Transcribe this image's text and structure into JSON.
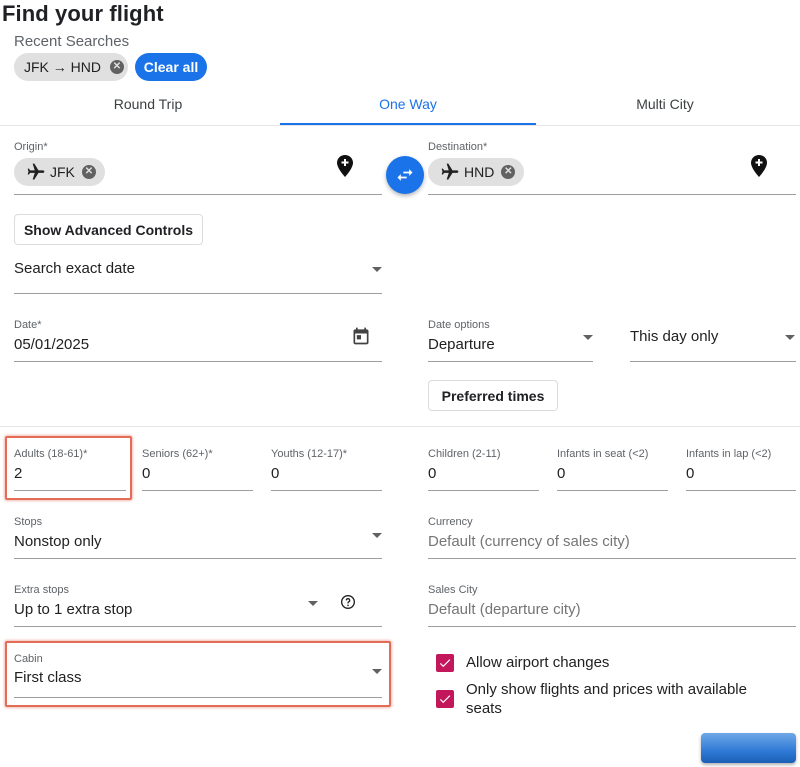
{
  "header": {
    "title": "Find your flight"
  },
  "recent": {
    "label": "Recent Searches",
    "chip": "JFK → HND",
    "clear_all": "Clear all"
  },
  "tabs": [
    {
      "label": "Round Trip",
      "active": false
    },
    {
      "label": "One Way",
      "active": true
    },
    {
      "label": "Multi City",
      "active": false
    }
  ],
  "origin": {
    "label": "Origin*",
    "chip": "JFK"
  },
  "destination": {
    "label": "Destination*",
    "chip": "HND"
  },
  "advanced": {
    "label": "Show Advanced Controls"
  },
  "search_mode": {
    "value": "Search exact date"
  },
  "date": {
    "label": "Date*",
    "value": "05/01/2025"
  },
  "date_options": {
    "label": "Date options",
    "value": "Departure"
  },
  "day_scope": {
    "value": "This day only"
  },
  "preferred_times": {
    "label": "Preferred times"
  },
  "passengers": {
    "adults": {
      "label": "Adults (18-61)*",
      "value": "2"
    },
    "seniors": {
      "label": "Seniors (62+)*",
      "value": "0"
    },
    "youths": {
      "label": "Youths (12-17)*",
      "value": "0"
    },
    "children": {
      "label": "Children (2-11)",
      "value": "0"
    },
    "infants_seat": {
      "label": "Infants in seat (<2)",
      "value": "0"
    },
    "infants_lap": {
      "label": "Infants in lap (<2)",
      "value": "0"
    }
  },
  "stops": {
    "label": "Stops",
    "value": "Nonstop only"
  },
  "currency": {
    "label": "Currency",
    "placeholder": "Default (currency of sales city)"
  },
  "extra_stops": {
    "label": "Extra stops",
    "value": "Up to 1 extra stop"
  },
  "sales_city": {
    "label": "Sales City",
    "placeholder": "Default (departure city)"
  },
  "cabin": {
    "label": "Cabin",
    "value": "First class"
  },
  "options": {
    "airport_changes": {
      "label": "Allow airport changes",
      "checked": true
    },
    "available_seats": {
      "label_line1": "Only show flights and prices with available",
      "label_line2": "seats",
      "checked": true
    }
  },
  "colors": {
    "accent": "#1a73e8",
    "checkbox": "#c2185b",
    "highlight": "#e26c55"
  },
  "icons": [
    "close-icon",
    "airplane-icon",
    "add-location-icon",
    "swap-icon",
    "calendar-icon",
    "help-icon",
    "check-icon",
    "dropdown-caret-icon"
  ]
}
